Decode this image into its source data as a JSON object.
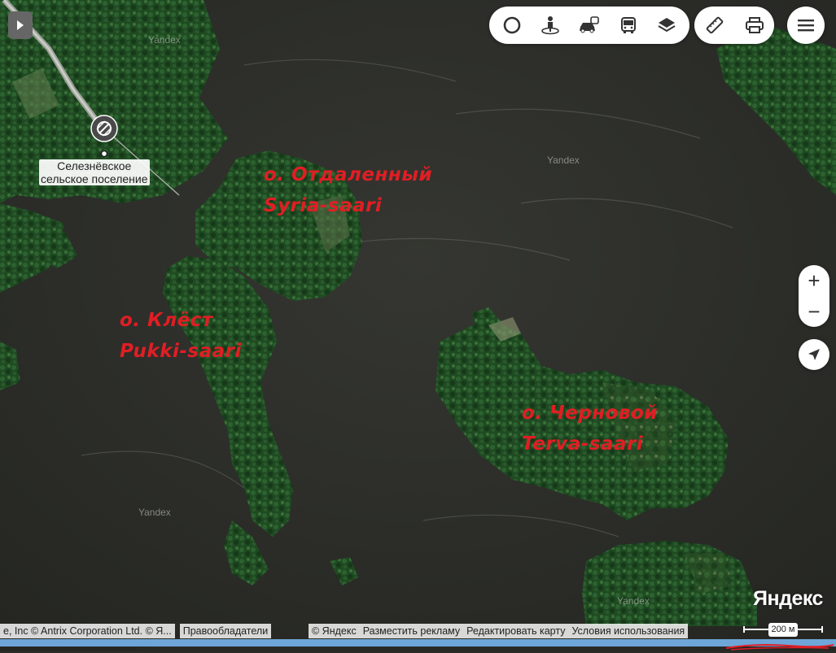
{
  "map": {
    "watermark": "Yandex",
    "settlement_label_line1": "Селезнёвское",
    "settlement_label_line2": "сельское поселение"
  },
  "islands": [
    {
      "name_ru": "о. Отдаленный",
      "name_fi": "Syria-saari"
    },
    {
      "name_ru": "о. Клёст",
      "name_fi": "Pukki-saari"
    },
    {
      "name_ru": "о. Черновой",
      "name_fi": "Terva-saari"
    }
  ],
  "toolbar": {
    "tools": [
      "traffic-icon",
      "panorama-person-icon",
      "cars-icon",
      "transit-bus-icon",
      "layers-icon"
    ],
    "ruler": "ruler-icon",
    "print": "printer-icon",
    "menu": "menu-icon"
  },
  "controls": {
    "zoom_in": "+",
    "zoom_out": "−",
    "locate": "location-arrow-icon"
  },
  "footer": {
    "attribution": "e, Inc © Antrix Corporation Ltd. © Я...",
    "rights_holders": "Правообладатели",
    "copyright": "© Яндекс",
    "advertise": "Разместить рекламу",
    "edit_map": "Редактировать карту",
    "terms": "Условия использования",
    "scale": "200 м"
  },
  "brand": "Яндекс",
  "colors": {
    "water": "#2b2c28",
    "forest": "#1f4a22",
    "label_red": "#e01e24",
    "link_bar": "#6fa6d8"
  }
}
